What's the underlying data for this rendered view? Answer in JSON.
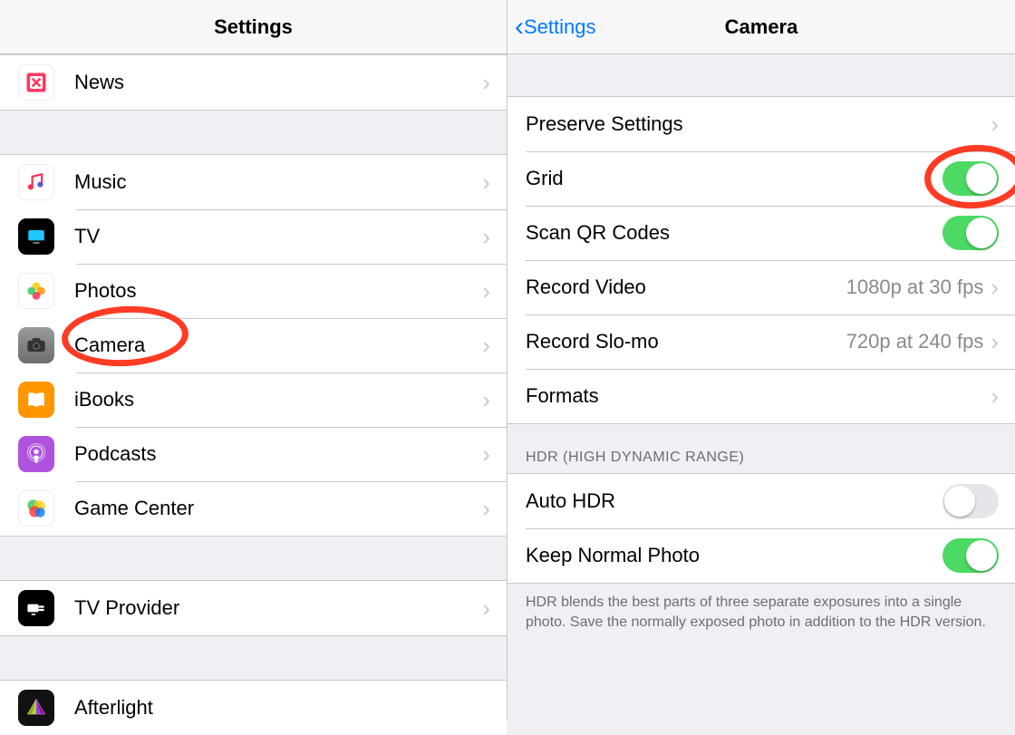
{
  "left": {
    "title": "Settings",
    "group1": [
      {
        "label": "News",
        "icon": "news"
      }
    ],
    "group2": [
      {
        "label": "Music",
        "icon": "music"
      },
      {
        "label": "TV",
        "icon": "tv"
      },
      {
        "label": "Photos",
        "icon": "photos"
      },
      {
        "label": "Camera",
        "icon": "camera"
      },
      {
        "label": "iBooks",
        "icon": "ibooks"
      },
      {
        "label": "Podcasts",
        "icon": "podcasts"
      },
      {
        "label": "Game Center",
        "icon": "gamecenter"
      }
    ],
    "group3": [
      {
        "label": "TV Provider",
        "icon": "tvprovider"
      }
    ],
    "group4": [
      {
        "label": "Afterlight",
        "icon": "afterlight"
      }
    ]
  },
  "right": {
    "back": "Settings",
    "title": "Camera",
    "group1": [
      {
        "label": "Preserve Settings",
        "kind": "nav"
      },
      {
        "label": "Grid",
        "kind": "toggle",
        "on": true
      },
      {
        "label": "Scan QR Codes",
        "kind": "toggle",
        "on": true
      },
      {
        "label": "Record Video",
        "kind": "nav",
        "value": "1080p at 30 fps"
      },
      {
        "label": "Record Slo-mo",
        "kind": "nav",
        "value": "720p at 240 fps"
      },
      {
        "label": "Formats",
        "kind": "nav"
      }
    ],
    "hdr_header": "HDR (HIGH DYNAMIC RANGE)",
    "group2": [
      {
        "label": "Auto HDR",
        "kind": "toggle",
        "on": false
      },
      {
        "label": "Keep Normal Photo",
        "kind": "toggle",
        "on": true
      }
    ],
    "hdr_footer": "HDR blends the best parts of three separate exposures into a single photo. Save the normally exposed photo in addition to the HDR version."
  }
}
